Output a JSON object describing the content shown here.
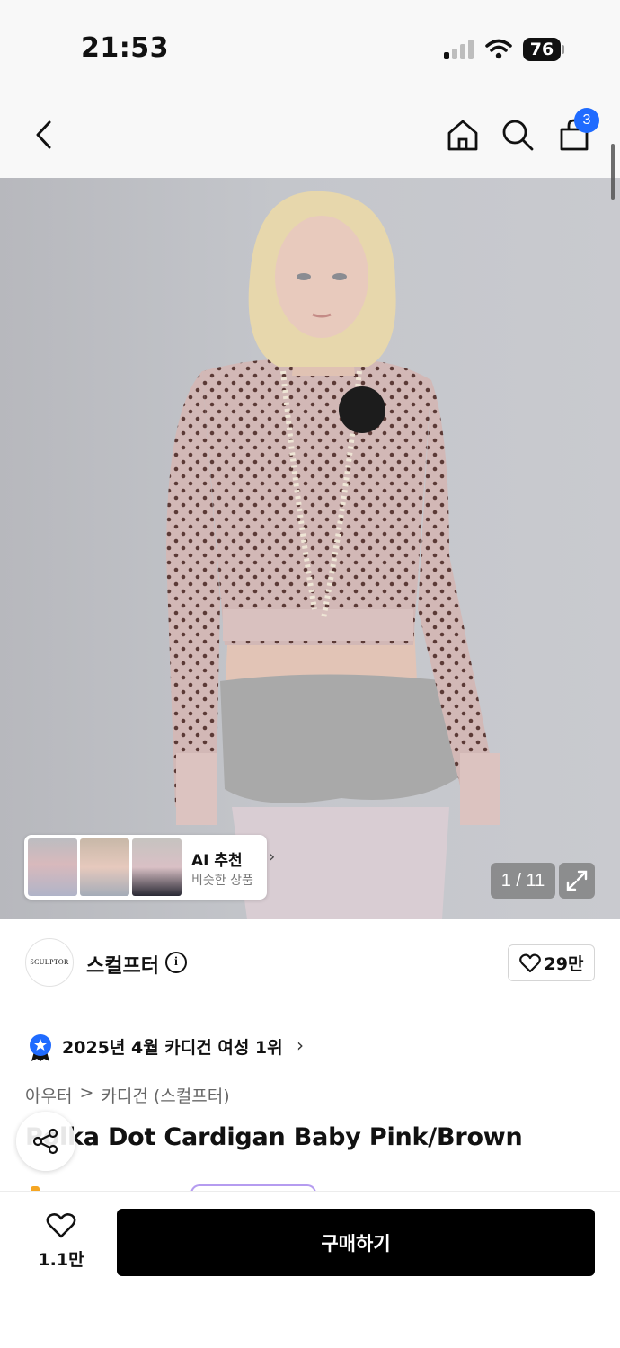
{
  "status_bar": {
    "time": "21:53",
    "battery": "76"
  },
  "header": {
    "cart_count": "3"
  },
  "gallery": {
    "counter": "1 / 11"
  },
  "ai_recommend": {
    "title": "AI 추천",
    "subtitle": "비슷한 상품"
  },
  "brand": {
    "logo_text": "SCULPTOR",
    "name": "스컬프터",
    "likes": "29만"
  },
  "ranking": {
    "text": "2025년 4월 카디건 여성 1위"
  },
  "breadcrumb": {
    "level1": "아우터",
    "separator": ">",
    "level2": "카디건 (스컬프터)"
  },
  "product": {
    "title": "Polka Dot Cardigan Baby Pink/Brown"
  },
  "bottom_bar": {
    "wish_count": "1.1만",
    "buy_label": "구매하기"
  },
  "colors": {
    "accent_blue": "#1f6bff",
    "buy_button": "#000000"
  },
  "icons": [
    "back-icon",
    "home-icon",
    "search-icon",
    "cart-icon",
    "expand-icon",
    "info-icon",
    "heart-icon",
    "ranking-badge-icon",
    "share-icon"
  ]
}
